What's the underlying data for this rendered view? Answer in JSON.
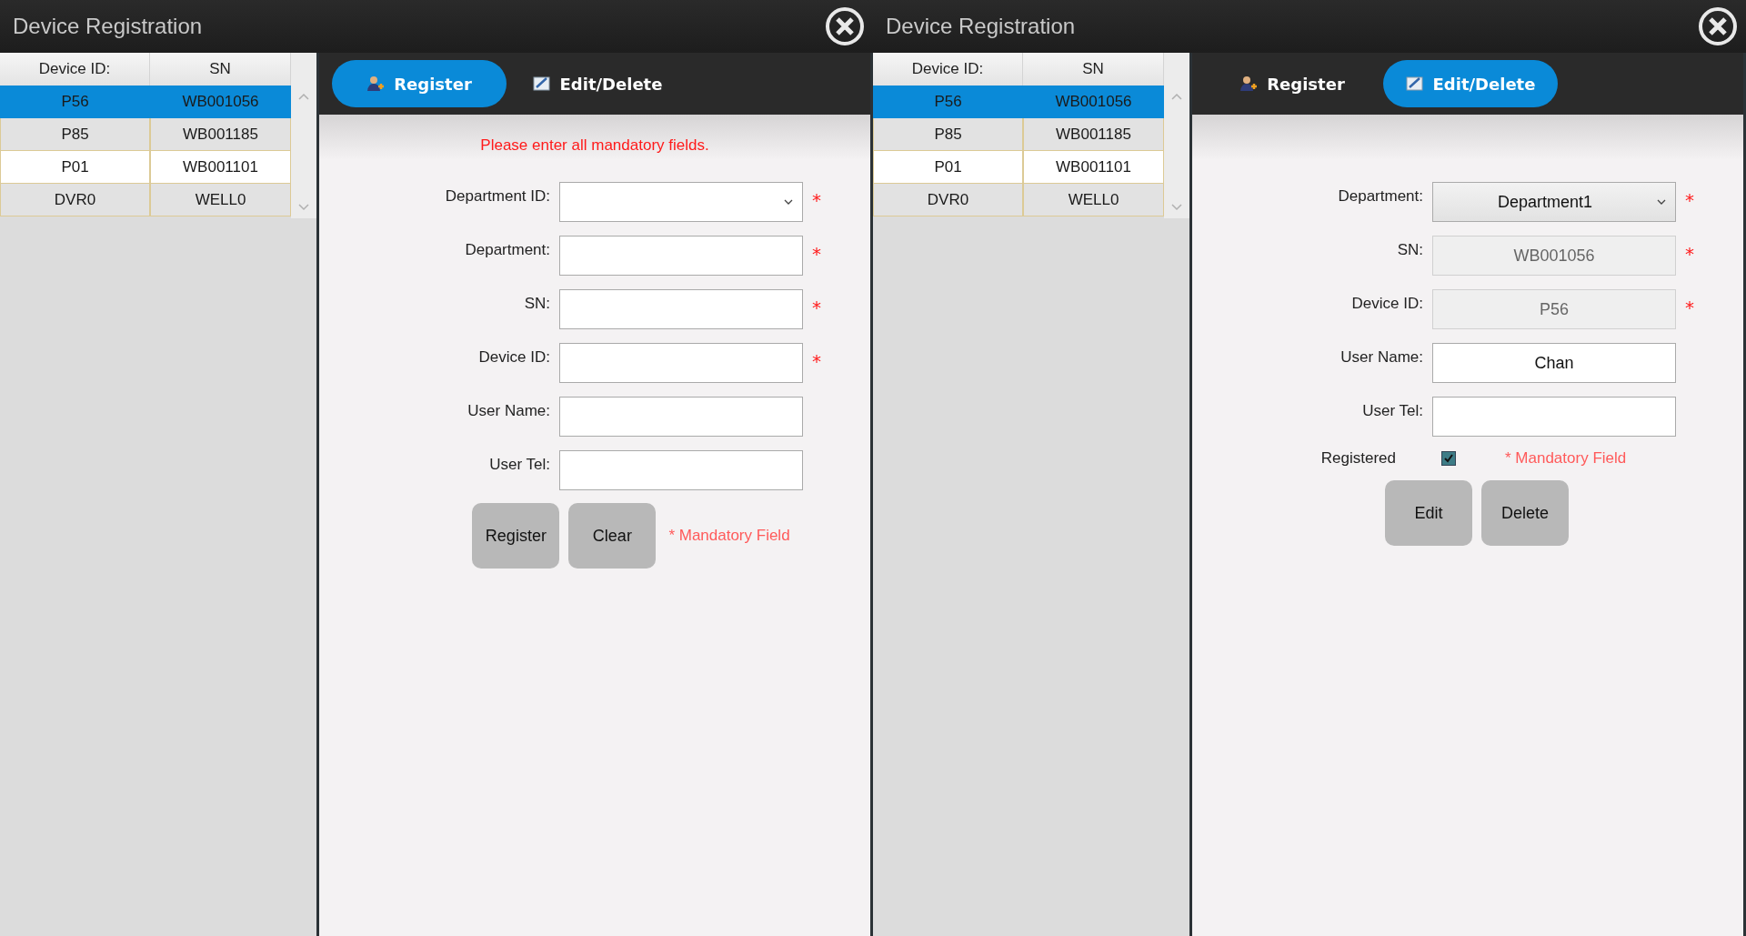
{
  "windows": [
    {
      "title": "Device Registration",
      "device_table": {
        "columns": [
          "Device ID:",
          "SN"
        ],
        "rows": [
          {
            "cells": [
              "P56",
              "WB001056"
            ],
            "selected": true
          },
          {
            "cells": [
              "P85",
              "WB001185"
            ],
            "selected": false
          },
          {
            "cells": [
              "P01",
              "WB001101"
            ],
            "selected": false
          },
          {
            "cells": [
              "DVR0",
              "WELL0"
            ],
            "selected": false
          }
        ]
      },
      "tabs": [
        {
          "label": "Register",
          "kind": "register",
          "selected": true
        },
        {
          "label": "Edit/Delete",
          "kind": "edit",
          "selected": false
        }
      ],
      "form": {
        "message": "Please enter all mandatory fields.",
        "fields": [
          {
            "label": "Department ID:",
            "kind": "dropdown",
            "required_mark": "*"
          },
          {
            "label": "Department:",
            "kind": "text",
            "required_mark": "*",
            "disabled": false
          },
          {
            "label": "SN:",
            "kind": "text",
            "required_mark": "*",
            "disabled": false
          },
          {
            "label": "Device ID:",
            "kind": "text",
            "required_mark": "*",
            "disabled": false
          },
          {
            "label": "User Name:",
            "kind": "text",
            "disabled": false
          },
          {
            "label": "User Tel:",
            "kind": "text",
            "disabled": false
          }
        ],
        "buttons": [
          "Register",
          "Clear"
        ],
        "note": "* Mandatory Field"
      }
    },
    {
      "title": "Device Registration",
      "device_table": {
        "columns": [
          "Device ID:",
          "SN"
        ],
        "rows": [
          {
            "cells": [
              "P56",
              "WB001056"
            ],
            "selected": true
          },
          {
            "cells": [
              "P85",
              "WB001185"
            ],
            "selected": false
          },
          {
            "cells": [
              "P01",
              "WB001101"
            ],
            "selected": false
          },
          {
            "cells": [
              "DVR0",
              "WELL0"
            ],
            "selected": false
          }
        ]
      },
      "tabs": [
        {
          "label": "Register",
          "kind": "register",
          "selected": false
        },
        {
          "label": "Edit/Delete",
          "kind": "edit",
          "selected": true
        }
      ],
      "form": {
        "fields": [
          {
            "label": "Department:",
            "kind": "dropdown",
            "value": "Department1",
            "required_mark": "*"
          },
          {
            "label": "SN:",
            "kind": "text",
            "value": "WB001056",
            "required_mark": "*",
            "disabled": true
          },
          {
            "label": "Device ID:",
            "kind": "text",
            "value": "P56",
            "required_mark": "*",
            "disabled": true
          },
          {
            "label": "User Name:",
            "kind": "text",
            "value": "Chan",
            "disabled": false
          },
          {
            "label": "User Tel:",
            "kind": "text",
            "disabled": false
          }
        ],
        "checkbox": {
          "label": "Registered",
          "checked": true
        },
        "buttons": [
          "Edit",
          "Delete"
        ],
        "note": "* Mandatory Field"
      }
    }
  ]
}
